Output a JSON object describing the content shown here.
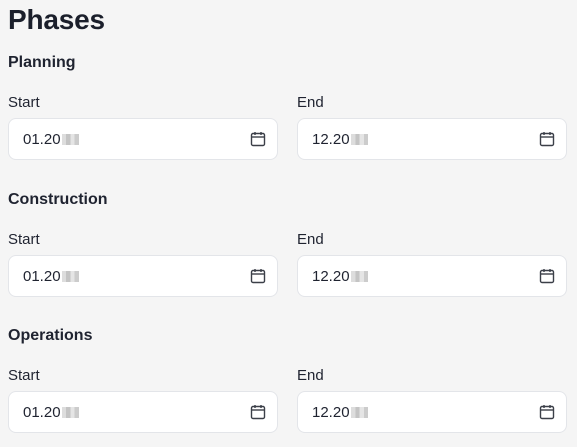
{
  "page": {
    "title": "Phases"
  },
  "phases": [
    {
      "name": "Planning",
      "start_label": "Start",
      "start_value": "01.20",
      "end_label": "End",
      "end_value": "12.20"
    },
    {
      "name": "Construction",
      "start_label": "Start",
      "start_value": "01.20",
      "end_label": "End",
      "end_value": "12.20"
    },
    {
      "name": "Operations",
      "start_label": "Start",
      "start_value": "01.20",
      "end_label": "End",
      "end_value": "12.20"
    }
  ],
  "icons": {
    "calendar": "calendar-icon"
  },
  "colors": {
    "background": "#f5f5f5",
    "input_bg": "#ffffff",
    "input_border": "#e3e5e9",
    "text": "#1f2330"
  }
}
